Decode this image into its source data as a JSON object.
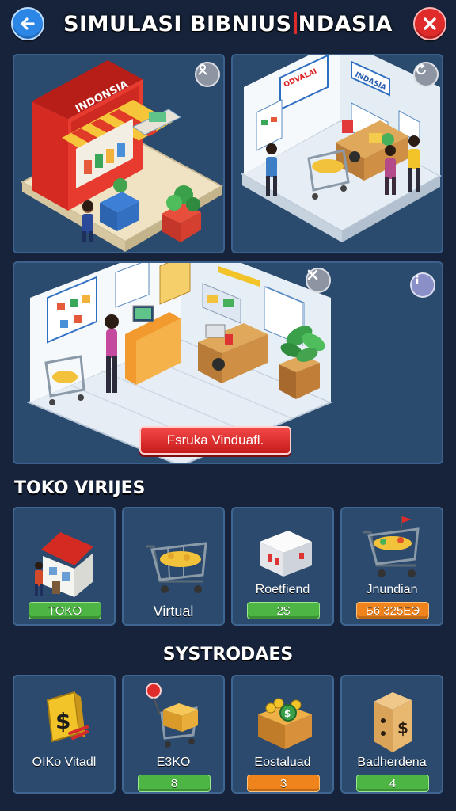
{
  "header": {
    "title_a": "SIMULASI BIBNIUS",
    "title_b": "NDASIA"
  },
  "scene_top_left": {
    "sign": "INDONSIA",
    "icon": "person-location-icon"
  },
  "scene_top_right": {
    "sign_left": "ODVALAI",
    "sign_right": "INDASIA",
    "icon": "refresh-icon"
  },
  "scene_main": {
    "cta_label": "Fsruka Vinduafl.",
    "close_icon": "close-icon",
    "info_icon": "info-icon"
  },
  "section_stores": {
    "title": "TOKO VIRIJES",
    "cards": [
      {
        "label": "",
        "badge": "TOKO",
        "badge_color": "green",
        "icon": "house-icon"
      },
      {
        "label": "Virtual",
        "badge": "",
        "icon": "shopping-cart-icon"
      },
      {
        "label": "Roetfiend",
        "badge": "2$",
        "badge_color": "green",
        "icon": "server-box-icon"
      },
      {
        "label": "Jnundian",
        "badge": "Б6 325ЕЭ",
        "badge_color": "orange",
        "icon": "cart-flag-icon"
      }
    ]
  },
  "section_systems": {
    "title": "SYSTRODAES",
    "cards": [
      {
        "label": "OIKo Vitadl",
        "badge": "",
        "icon": "money-tag-icon"
      },
      {
        "label": "E3KO",
        "badge": "8",
        "badge_color": "green",
        "icon": "cart-pin-icon"
      },
      {
        "label": "Eostaluad",
        "badge": "3",
        "badge_color": "orange",
        "icon": "coin-crate-icon"
      },
      {
        "label": "Badherdena",
        "badge": "4",
        "badge_color": "green",
        "icon": "money-bag-icon"
      }
    ]
  },
  "colors": {
    "background": "#16233a",
    "panel": "#2a4a6e",
    "accent_red": "#e02b2b",
    "accent_blue": "#2b86e6",
    "badge_green": "#4cb543",
    "badge_orange": "#f0841c"
  }
}
